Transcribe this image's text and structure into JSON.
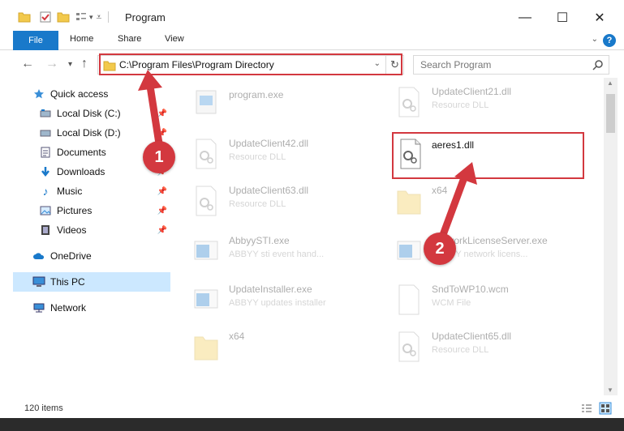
{
  "window": {
    "title": "Program",
    "minimize_glyph": "—",
    "maximize_glyph": "☐",
    "close_glyph": "✕"
  },
  "ribbon": {
    "file": "File",
    "home": "Home",
    "share": "Share",
    "view": "View",
    "help": "?"
  },
  "nav": {
    "address": "C:\\Program Files\\Program Directory",
    "search_placeholder": "Search Program"
  },
  "sidebar": {
    "items": [
      {
        "label": "Quick access",
        "icon": "star-icon",
        "pinned": false
      },
      {
        "label": "Local Disk (C:)",
        "icon": "drive-icon",
        "pinned": true
      },
      {
        "label": "Local Disk (D:)",
        "icon": "drive-icon",
        "pinned": true
      },
      {
        "label": "Documents",
        "icon": "documents-icon",
        "pinned": true
      },
      {
        "label": "Downloads",
        "icon": "download-icon",
        "pinned": true
      },
      {
        "label": "Music",
        "icon": "music-icon",
        "pinned": true
      },
      {
        "label": "Pictures",
        "icon": "pictures-icon",
        "pinned": true
      },
      {
        "label": "Videos",
        "icon": "videos-icon",
        "pinned": true
      },
      {
        "label": "OneDrive",
        "icon": "cloud-icon",
        "pinned": false
      },
      {
        "label": "This PC",
        "icon": "pc-icon",
        "pinned": false
      },
      {
        "label": "Network",
        "icon": "network-icon",
        "pinned": false
      }
    ]
  },
  "files": [
    {
      "name": "program.exe",
      "desc": "",
      "icon": "exe-icon",
      "faded": true
    },
    {
      "name": "UpdateClient21.dll",
      "desc": "Resource DLL",
      "icon": "dll-icon",
      "faded": true
    },
    {
      "name": "UpdateClient42.dll",
      "desc": "Resource DLL",
      "icon": "dll-icon",
      "faded": true
    },
    {
      "name": "aeres1.dll",
      "desc": "",
      "icon": "dll-icon",
      "faded": false
    },
    {
      "name": "UpdateClient63.dll",
      "desc": "Resource DLL",
      "icon": "dll-icon",
      "faded": true
    },
    {
      "name": "x64",
      "desc": "",
      "icon": "folder-icon",
      "faded": true
    },
    {
      "name": "AbbyySTI.exe",
      "desc": "ABBYY sti event hand...",
      "icon": "app-icon",
      "faded": true
    },
    {
      "name": "NetworkLicenseServer.exe",
      "desc": "ABBYY network licens...",
      "icon": "app-icon",
      "faded": true
    },
    {
      "name": "UpdateInstaller.exe",
      "desc": "ABBYY updates installer",
      "icon": "app-icon",
      "faded": true
    },
    {
      "name": "SndToWP10.wcm",
      "desc": "WCM File",
      "icon": "file-icon",
      "faded": true
    },
    {
      "name": "x64",
      "desc": "",
      "icon": "folder-icon",
      "faded": true
    },
    {
      "name": "UpdateClient65.dll",
      "desc": "Resource DLL",
      "icon": "dll-icon",
      "faded": true
    }
  ],
  "status": {
    "count": "120 items"
  },
  "annotations": {
    "badge1": "1",
    "badge2": "2"
  },
  "colors": {
    "accent": "#1979ca",
    "highlight": "#d3383f",
    "selected": "#cce8ff"
  }
}
